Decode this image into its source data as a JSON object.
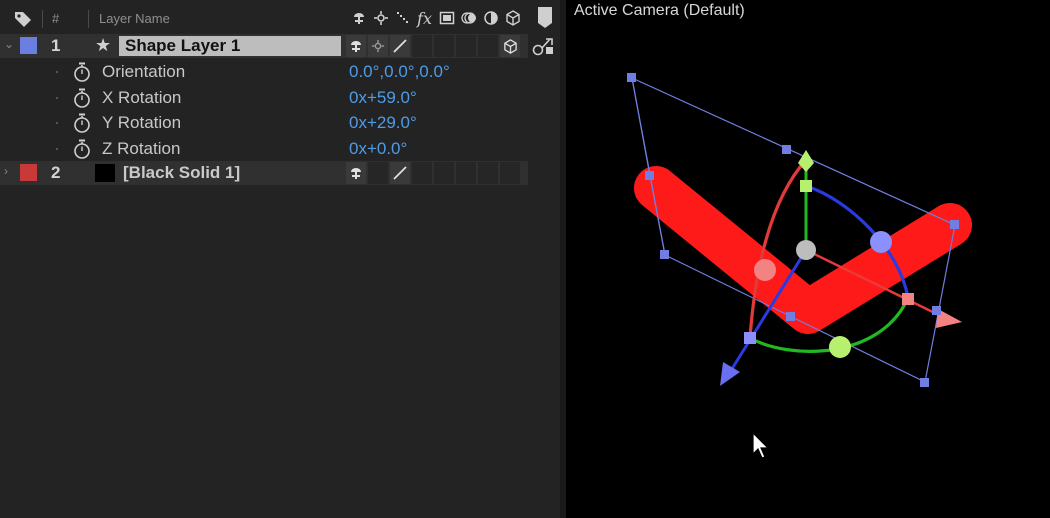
{
  "timeline": {
    "header": {
      "hash": "#",
      "layer_name": "Layer Name"
    },
    "header_icons": [
      "shy-icon",
      "collapse-icon",
      "quality-icon",
      "fx-icon",
      "frame-blend-icon",
      "motion-blur-icon",
      "adjustment-icon",
      "3d-icon"
    ],
    "header_fx_text": "fx",
    "layers": [
      {
        "number": "1",
        "name": "Shape Layer 1",
        "color": "#6a7fe0",
        "properties": [
          {
            "label": "Orientation",
            "value": "0.0°,0.0°,0.0°"
          },
          {
            "label": "X Rotation",
            "value": "0x+59.0°"
          },
          {
            "label": "Y Rotation",
            "value": "0x+29.0°"
          },
          {
            "label": "Z Rotation",
            "value": "0x+0.0°"
          }
        ]
      },
      {
        "number": "2",
        "name": "[Black Solid 1]",
        "color": "#c83a3a"
      }
    ]
  },
  "viewer": {
    "title": "Active Camera (Default)",
    "colors": {
      "shape_stroke": "#ff1a1a",
      "bounding_box": "#6f7ee0",
      "x_axis": "#ea3a3a",
      "y_axis": "#22b822",
      "z_axis": "#2a3ae0",
      "x_handle": "#f38383",
      "y_handle": "#b6f06e",
      "z_handle": "#8c90ff"
    }
  }
}
